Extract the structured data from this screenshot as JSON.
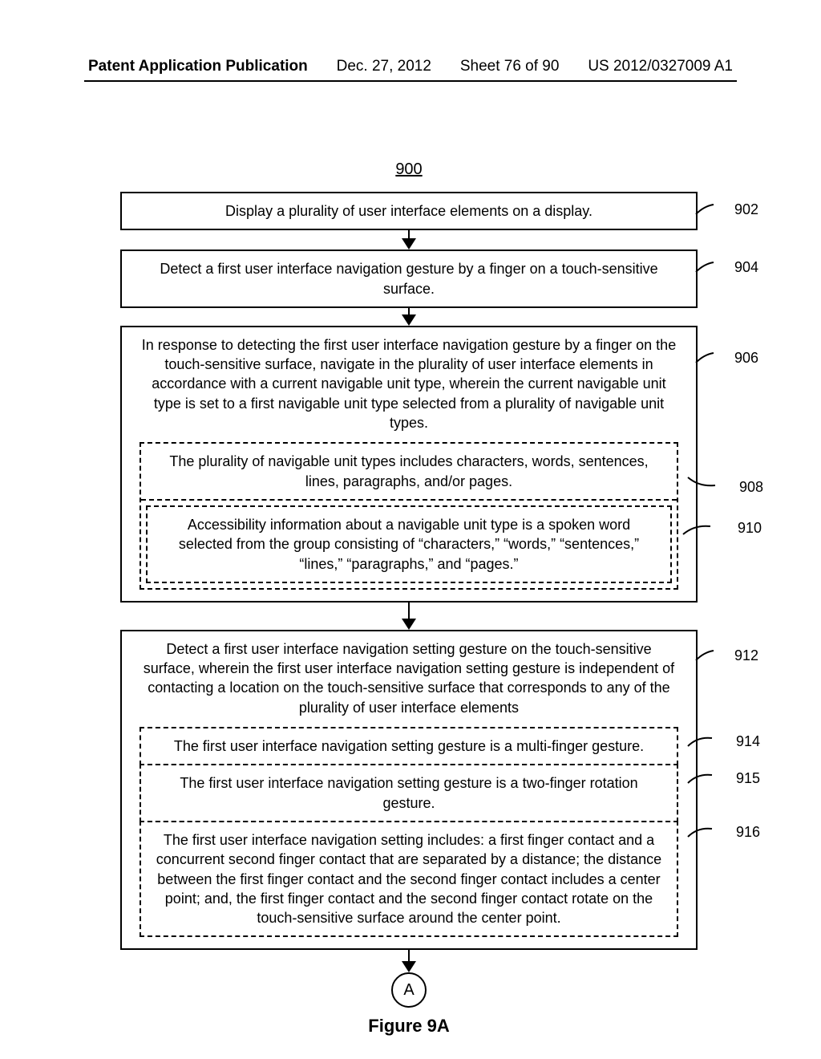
{
  "header": {
    "pub_type": "Patent Application Publication",
    "date": "Dec. 27, 2012",
    "sheet": "Sheet 76 of 90",
    "pub_no": "US 2012/0327009 A1"
  },
  "chart_data": {
    "type": "flowchart",
    "title": "900",
    "figure_label": "Figure 9A",
    "off_page_connector": "A",
    "nodes": [
      {
        "id": 902,
        "ref": "902",
        "style": "solid",
        "text": "Display a plurality of user interface elements on a display."
      },
      {
        "id": 904,
        "ref": "904",
        "style": "solid",
        "text": "Detect a first user interface navigation gesture by a finger on a touch-sensitive surface."
      },
      {
        "id": 906,
        "ref": "906",
        "style": "solid",
        "text": "In response to detecting the first user interface navigation gesture by a finger on the touch-sensitive surface, navigate in the plurality of user interface elements in accordance with a current navigable unit type, wherein the current navigable unit type is set to a first navigable unit type selected from a plurality of navigable unit types.",
        "children": [
          {
            "id": 908,
            "ref": "908",
            "style": "dashed",
            "text": "The plurality of navigable unit types includes characters, words, sentences, lines, paragraphs, and/or pages."
          },
          {
            "id": 910,
            "ref": "910",
            "style": "dashed",
            "text": "Accessibility information about a navigable unit type is a spoken word selected from the group consisting of  “characters,” “words,” “sentences,” “lines,” “paragraphs,” and “pages.”"
          }
        ]
      },
      {
        "id": 912,
        "ref": "912",
        "style": "solid",
        "text": "Detect a first user interface navigation setting gesture on the touch-sensitive surface, wherein the first user interface navigation setting gesture is independent of contacting a location on the touch-sensitive surface that corresponds to any of the plurality of user interface elements",
        "children": [
          {
            "id": 914,
            "ref": "914",
            "style": "dashed",
            "text": "The first user interface navigation setting gesture is a multi-finger gesture."
          },
          {
            "id": 915,
            "ref": "915",
            "style": "dashed",
            "text": "The first user interface navigation setting gesture is a two-finger rotation gesture."
          },
          {
            "id": 916,
            "ref": "916",
            "style": "dashed",
            "text": "The first user interface navigation setting includes: a first finger contact and a concurrent second finger contact that are separated by a distance; the distance between the first finger contact and the second finger contact includes a center point; and, the first finger contact and the second finger contact rotate on the touch-sensitive surface around the center point."
          }
        ]
      }
    ],
    "edges": [
      {
        "from": 902,
        "to": 904
      },
      {
        "from": 904,
        "to": 906
      },
      {
        "from": 906,
        "to": 912
      },
      {
        "from": 912,
        "to": "A"
      }
    ]
  }
}
